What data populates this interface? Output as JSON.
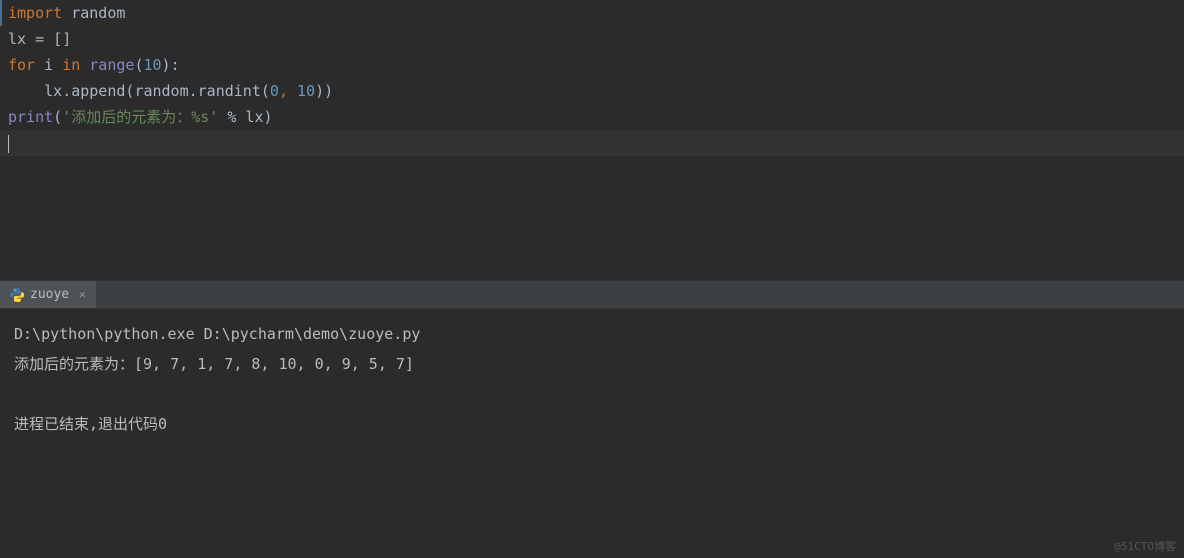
{
  "code": {
    "line1": {
      "kw_import": "import",
      "space": " ",
      "module": "random"
    },
    "line2": {
      "var": "lx",
      "sp1": " ",
      "eq": "=",
      "sp2": " ",
      "br1": "[",
      "br2": "]"
    },
    "line3": {
      "kw_for": "for",
      "sp1": " ",
      "var_i": "i",
      "sp2": " ",
      "kw_in": "in",
      "sp3": " ",
      "fn": "range",
      "p1": "(",
      "num": "10",
      "p2": ")",
      "colon": ":"
    },
    "line4": {
      "indent": "    ",
      "var_lx": "lx",
      "dot1": ".",
      "fn_append": "append",
      "p1": "(",
      "var_random": "random",
      "dot2": ".",
      "fn_randint": "randint",
      "p2": "(",
      "n1": "0",
      "comma": ",",
      "sp": " ",
      "n2": "10",
      "p3": ")",
      "p4": ")"
    },
    "line5": {
      "fn": "print",
      "p1": "(",
      "q1": "'",
      "str": "添加后的元素为：",
      "fmt": "%s",
      "q2": "'",
      "sp1": " ",
      "pct": "%",
      "sp2": " ",
      "var_lx": "lx",
      "p2": ")"
    }
  },
  "tab": {
    "name": "zuoye"
  },
  "console": {
    "line1": "D:\\python\\python.exe D:\\pycharm\\demo\\zuoye.py",
    "line2": "添加后的元素为：[9, 7, 1, 7, 8, 10, 0, 9, 5, 7]",
    "line3": "",
    "line4": "进程已结束,退出代码0"
  },
  "watermark": "@51CTO博客"
}
